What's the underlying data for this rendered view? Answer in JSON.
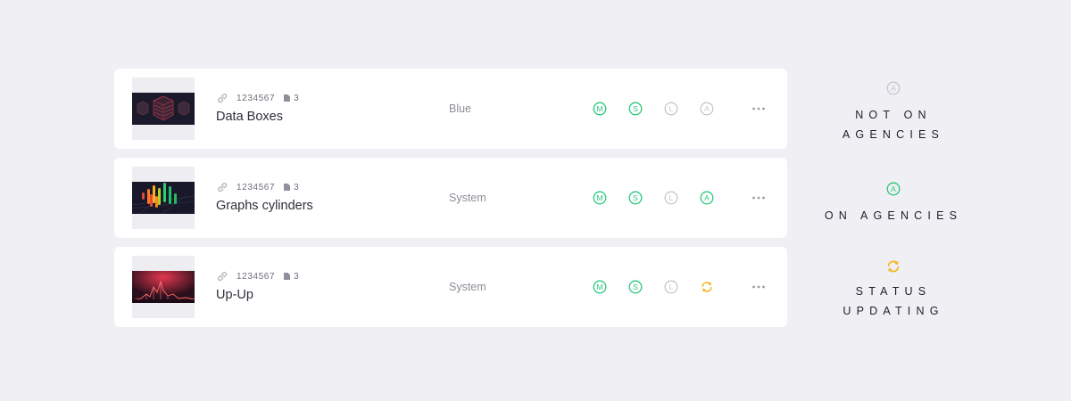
{
  "items": [
    {
      "id_text": "1234567",
      "count": "3",
      "title": "Data Boxes",
      "category": "Blue",
      "thumbnail": "data-boxes-thumbnail",
      "statuses": [
        "M",
        "S",
        "L",
        "A"
      ],
      "status_states": [
        "on",
        "on",
        "off",
        "off"
      ]
    },
    {
      "id_text": "1234567",
      "count": "3",
      "title": "Graphs cylinders",
      "category": "System",
      "thumbnail": "graphs-cylinders-thumbnail",
      "statuses": [
        "M",
        "S",
        "L",
        "A"
      ],
      "status_states": [
        "on",
        "on",
        "off",
        "on"
      ]
    },
    {
      "id_text": "1234567",
      "count": "3",
      "title": "Up-Up",
      "category": "System",
      "thumbnail": "up-up-thumbnail",
      "statuses": [
        "M",
        "S",
        "L"
      ],
      "status_states": [
        "on",
        "on",
        "off",
        "updating"
      ]
    }
  ],
  "legend": [
    {
      "letter": "A",
      "icon": "a-circle-gray-icon",
      "lines": [
        "Not on",
        "agencies"
      ]
    },
    {
      "letter": "A",
      "icon": "a-circle-green-icon",
      "lines": [
        "On agencies"
      ]
    },
    {
      "icon": "sync-arrows-icon",
      "lines": [
        "Status",
        "updating"
      ]
    }
  ],
  "colors": {
    "active": "#27c97a",
    "inactive": "#c6c7cd",
    "updating": "#f4b41d",
    "background": "#f0eff4",
    "card": "#ffffff"
  }
}
